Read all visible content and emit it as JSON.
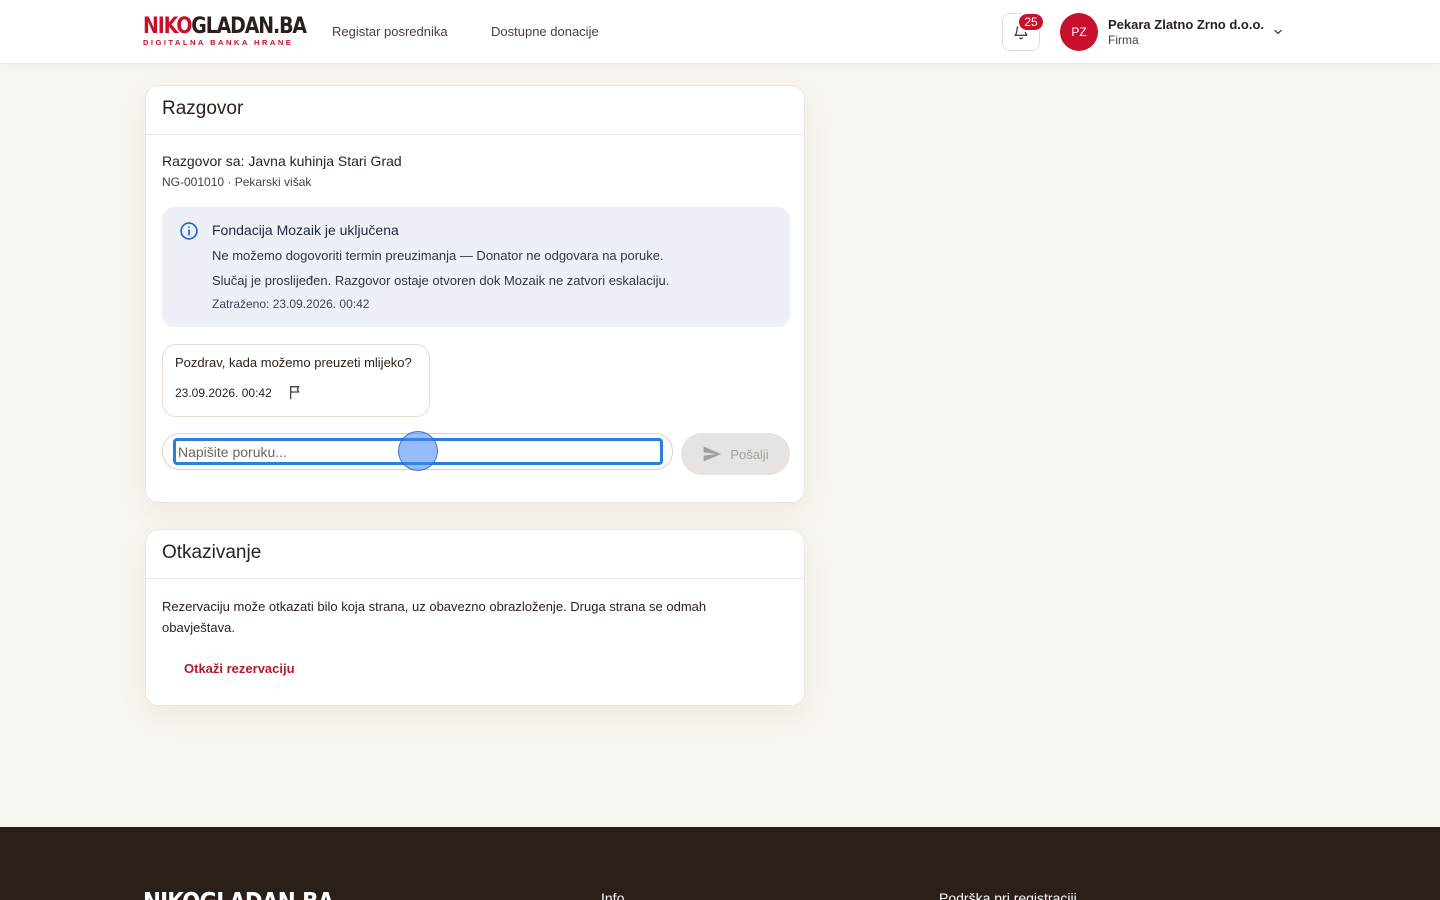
{
  "brand": {
    "name_part1": "NIKO",
    "name_part2": "GLADAN.BA",
    "tagline": "DIGITALNA BANKA HRANE",
    "accent_color": "#c8102e"
  },
  "nav": {
    "items": [
      {
        "label": "Registar posrednika"
      },
      {
        "label": "Dostupne donacije"
      }
    ]
  },
  "header": {
    "notifications_count": "25",
    "user_initials": "PZ",
    "user_name": "Pekara Zlatno Zrno d.o.o.",
    "user_role": "Firma"
  },
  "conversation": {
    "title": "Razgovor",
    "with_label": "Razgovor sa: Javna kuhinja Stari Grad",
    "reference": "NG-001010 · Pekarski višak",
    "escalation": {
      "title": "Fondacija Mozaik je uključena",
      "reason": "Ne možemo dogovoriti termin preuzimanja — Donator ne odgovara na poruke.",
      "status": "Slučaj je proslijeđen. Razgovor ostaje otvoren dok Mozaik ne zatvori eskalaciju.",
      "requested_at": "Zatraženo: 23.09.2026. 00:42"
    },
    "messages": [
      {
        "text": "Pozdrav, kada možemo preuzeti mlijeko?",
        "time": "23.09.2026. 00:42"
      }
    ],
    "input": {
      "placeholder": "Napišite poruku...",
      "value": ""
    },
    "send_label": "Pošalji"
  },
  "cancellation": {
    "title": "Otkazivanje",
    "description": "Rezervaciju može otkazati bilo koja strana, uz obavezno obrazloženje. Druga strana se odmah obavještava.",
    "button_label": "Otkaži rezervaciju"
  },
  "footer": {
    "logo": "NIKOGLADAN.BA",
    "col1_title": "Info",
    "col2_title": "Podrška pri registraciji"
  },
  "icons": {
    "bell": "bell-icon",
    "chevron": "chevron-down-icon",
    "info": "info-icon",
    "flag": "flag-icon",
    "send": "send-icon"
  }
}
